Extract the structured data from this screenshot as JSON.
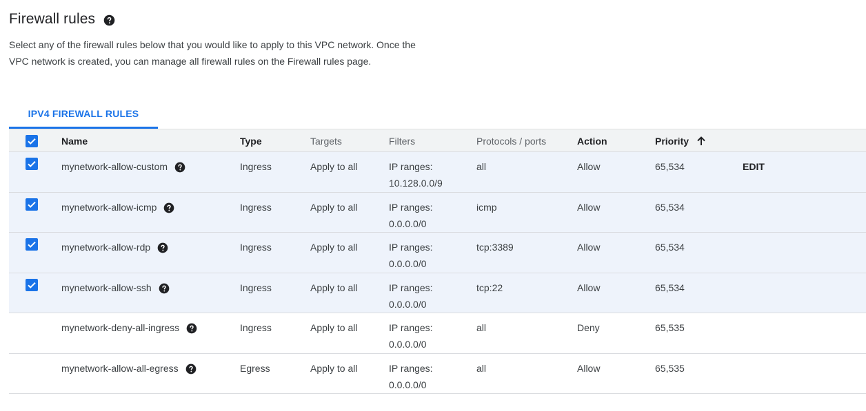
{
  "header": {
    "title": "Firewall rules",
    "description": "Select any of the firewall rules below that you would like to apply to this VPC network. Once the VPC network is created, you can manage all firewall rules on the Firewall rules page."
  },
  "tabs": [
    {
      "label": "IPV4 FIREWALL RULES",
      "active": true
    }
  ],
  "columns": {
    "name": "Name",
    "type": "Type",
    "targets": "Targets",
    "filters": "Filters",
    "protocols": "Protocols / ports",
    "action": "Action",
    "priority": "Priority"
  },
  "select_all_checked": true,
  "edit_label": "EDIT",
  "rows": [
    {
      "checked": true,
      "name": "mynetwork-allow-custom",
      "type": "Ingress",
      "targets": "Apply to all",
      "filter_label": "IP ranges:",
      "filter_value": "10.128.0.0/9",
      "protocols": "all",
      "action": "Allow",
      "priority": "65,534"
    },
    {
      "checked": true,
      "name": "mynetwork-allow-icmp",
      "type": "Ingress",
      "targets": "Apply to all",
      "filter_label": "IP ranges:",
      "filter_value": "0.0.0.0/0",
      "protocols": "icmp",
      "action": "Allow",
      "priority": "65,534"
    },
    {
      "checked": true,
      "name": "mynetwork-allow-rdp",
      "type": "Ingress",
      "targets": "Apply to all",
      "filter_label": "IP ranges:",
      "filter_value": "0.0.0.0/0",
      "protocols": "tcp:3389",
      "action": "Allow",
      "priority": "65,534"
    },
    {
      "checked": true,
      "name": "mynetwork-allow-ssh",
      "type": "Ingress",
      "targets": "Apply to all",
      "filter_label": "IP ranges:",
      "filter_value": "0.0.0.0/0",
      "protocols": "tcp:22",
      "action": "Allow",
      "priority": "65,534"
    },
    {
      "checked": false,
      "name": "mynetwork-deny-all-ingress",
      "type": "Ingress",
      "targets": "Apply to all",
      "filter_label": "IP ranges:",
      "filter_value": "0.0.0.0/0",
      "protocols": "all",
      "action": "Deny",
      "priority": "65,535"
    },
    {
      "checked": false,
      "name": "mynetwork-allow-all-egress",
      "type": "Egress",
      "targets": "Apply to all",
      "filter_label": "IP ranges:",
      "filter_value": "0.0.0.0/0",
      "protocols": "all",
      "action": "Allow",
      "priority": "65,535"
    }
  ],
  "icons": {
    "help": "help-circle-icon",
    "sort": "arrow-up-icon",
    "checkbox": "check-icon"
  },
  "colors": {
    "accent": "#1a73e8",
    "selected_row": "#eef3fb",
    "header_bg": "#f1f3f4"
  }
}
